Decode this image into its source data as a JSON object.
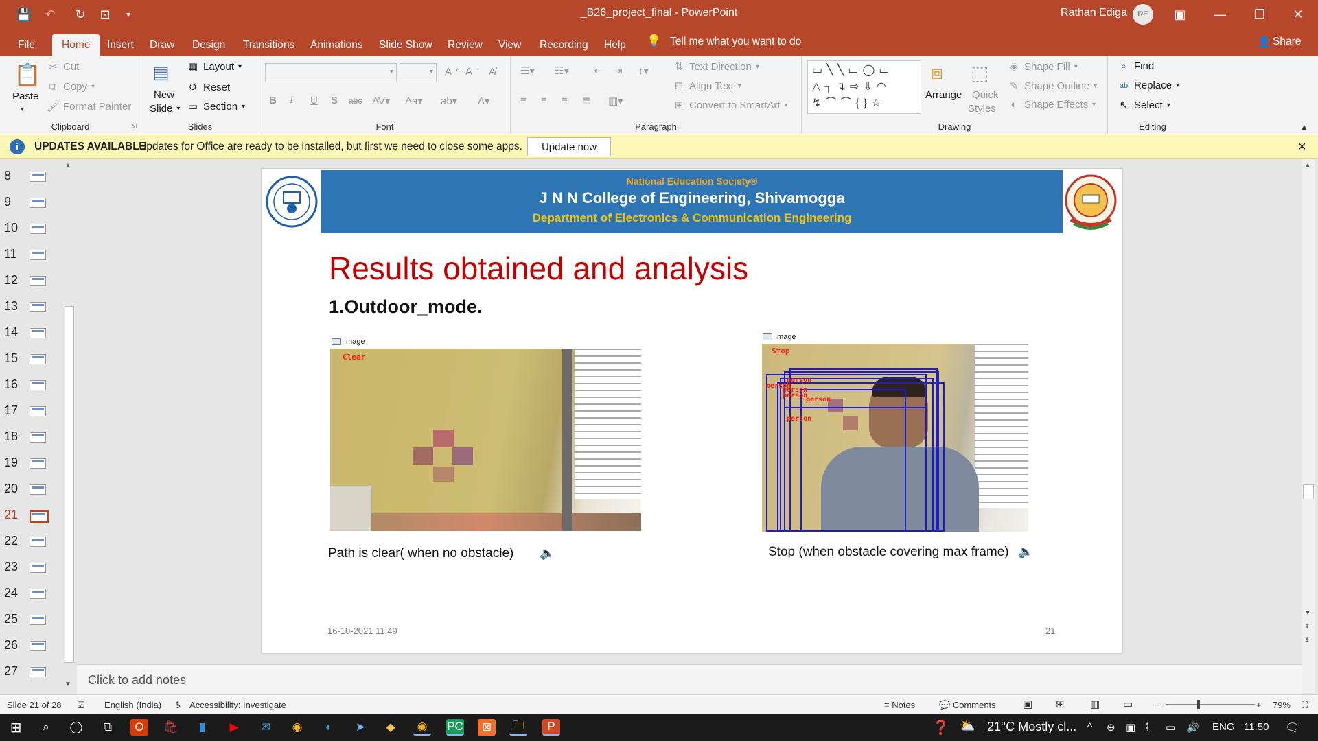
{
  "window": {
    "title": "_B26_project_final  -  PowerPoint",
    "user": "Rathan Ediga",
    "avatar_initials": "RE"
  },
  "tabs": [
    "File",
    "Home",
    "Insert",
    "Draw",
    "Design",
    "Transitions",
    "Animations",
    "Slide Show",
    "Review",
    "View",
    "Recording",
    "Help"
  ],
  "active_tab": "Home",
  "tell_me": "Tell me what you want to do",
  "share": "Share",
  "ribbon": {
    "clipboard": {
      "label": "Clipboard",
      "paste": "Paste",
      "cut": "Cut",
      "copy": "Copy",
      "format_painter": "Format Painter"
    },
    "slides": {
      "label": "Slides",
      "new_slide": "New",
      "new_slide2": "Slide",
      "layout": "Layout",
      "reset": "Reset",
      "section": "Section"
    },
    "font": {
      "label": "Font"
    },
    "paragraph": {
      "label": "Paragraph",
      "text_direction": "Text Direction",
      "align_text": "Align Text",
      "convert": "Convert to SmartArt"
    },
    "drawing": {
      "label": "Drawing",
      "arrange": "Arrange",
      "quick": "Quick",
      "styles": "Styles",
      "shape_fill": "Shape Fill",
      "shape_outline": "Shape Outline",
      "shape_effects": "Shape Effects"
    },
    "editing": {
      "label": "Editing",
      "find": "Find",
      "replace": "Replace",
      "select": "Select"
    }
  },
  "infobar": {
    "title": "UPDATES AVAILABLE",
    "message": "Updates for Office are ready to be installed, but first we need to close some apps.",
    "button": "Update now"
  },
  "thumbnails": [
    "8",
    "9",
    "10",
    "11",
    "12",
    "13",
    "14",
    "15",
    "16",
    "17",
    "18",
    "19",
    "20",
    "21",
    "22",
    "23",
    "24",
    "25",
    "26",
    "27"
  ],
  "current_slide_number": "21",
  "slide": {
    "society": "National Education Society®",
    "college": "J N N College of Engineering, Shivamogga",
    "department": "Department of Electronics & Communication Engineering",
    "title": "Results obtained and analysis",
    "subtitle": "1.Outdoor_mode.",
    "left_window_label": "Image",
    "left_overlay": "Clear",
    "right_window_label": "Image",
    "right_overlay": "Stop",
    "person_label": "person",
    "left_caption": "Path is clear( when no obstacle)",
    "right_caption": "Stop (when obstacle covering max frame)",
    "date": "16-10-2021 11:49",
    "number": "21"
  },
  "notes_placeholder": "Click to add notes",
  "status": {
    "slide_of": "Slide 21 of 28",
    "language": "English (India)",
    "accessibility": "Accessibility: Investigate",
    "notes": "Notes",
    "comments": "Comments",
    "zoom": "79%"
  },
  "taskbar": {
    "weather": "21°C  Mostly cl...",
    "lang": "ENG",
    "time": "11:50"
  }
}
